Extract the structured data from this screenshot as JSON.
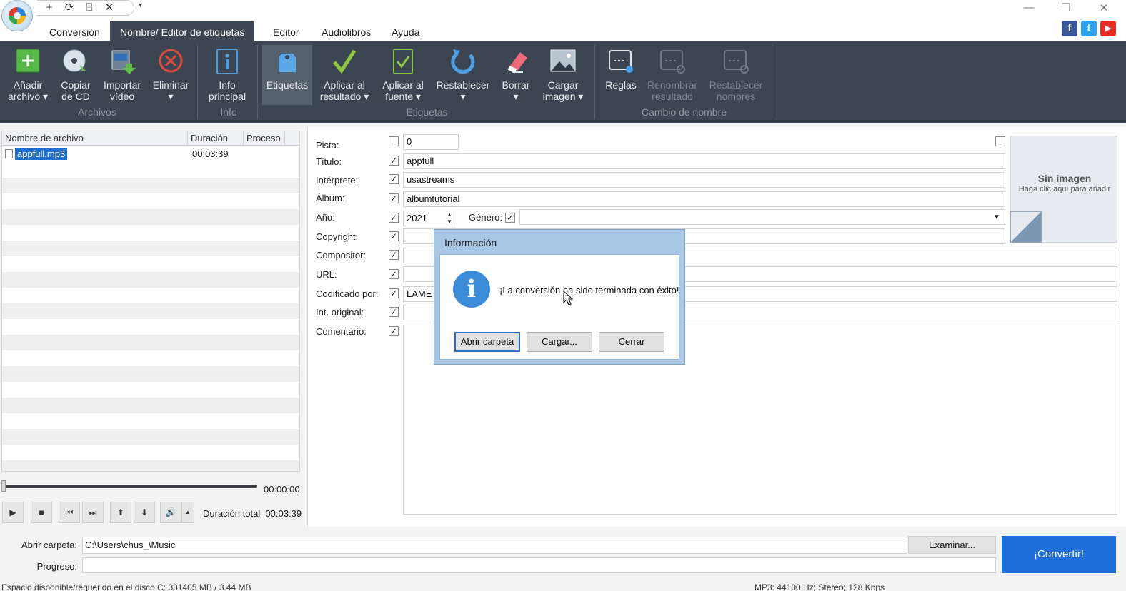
{
  "titlebar": {
    "qat_icons": [
      "plus-icon",
      "refresh-icon",
      "edit-doc-icon",
      "close-icon"
    ],
    "qat_glyphs": [
      "+",
      "⟳",
      "⌸",
      "✕"
    ],
    "more": "▾",
    "controls": {
      "minimize": "—",
      "restore": "❐",
      "close": "✕"
    }
  },
  "menu": {
    "tabs": [
      "Conversión",
      "Nombre/ Editor de etiquetas",
      "Editor",
      "Audiolibros",
      "Ayuda"
    ],
    "active": 1
  },
  "social": {
    "facebook": "f",
    "twitter": "t",
    "youtube": "▶",
    "colors": {
      "facebook": "#3b5998",
      "twitter": "#2aa3ef",
      "youtube": "#e52d27"
    }
  },
  "ribbon": {
    "buttons": [
      {
        "label": "Añadir\narchivo ▾",
        "icon": "add-file-icon"
      },
      {
        "label": "Copiar\nde CD",
        "icon": "cd-copy-icon"
      },
      {
        "label": "Importar\nvídeo",
        "icon": "import-video-icon"
      },
      {
        "label": "Eliminar\n▾",
        "icon": "delete-icon"
      },
      {
        "label": "Info\nprincipal",
        "icon": "info-icon"
      },
      {
        "label": "Etiquetas",
        "icon": "tag-icon"
      },
      {
        "label": "Aplicar al\nresultado ▾",
        "icon": "checkmark-icon"
      },
      {
        "label": "Aplicar al\nfuente ▾",
        "icon": "check-doc-icon"
      },
      {
        "label": "Restablecer\n▾",
        "icon": "undo-icon"
      },
      {
        "label": "Borrar\n▾",
        "icon": "eraser-icon"
      },
      {
        "label": "Cargar\nimagen ▾",
        "icon": "image-icon"
      },
      {
        "label": "Reglas",
        "icon": "rules-icon"
      },
      {
        "label": "Renombrar\nresultado",
        "icon": "rename-result-icon"
      },
      {
        "label": "Restablecer\nnombres",
        "icon": "reset-names-icon"
      }
    ],
    "groups": [
      "Archivos",
      "Info",
      "Etiquetas",
      "Cambio de nombre"
    ]
  },
  "filelist": {
    "columns": [
      "Nombre de archivo",
      "Duración",
      "Proceso"
    ],
    "rows": [
      {
        "name": "appfull.mp3",
        "duration": "00:03:39",
        "process": ""
      }
    ]
  },
  "player": {
    "position": "00:00:00",
    "total_label": "Duración total",
    "total": "00:03:39",
    "buttons": [
      "▶",
      "■",
      "⏮",
      "⏭",
      "⬆",
      "⬇",
      "🔊",
      "▲"
    ]
  },
  "tags": {
    "labels": {
      "pista": "Pista:",
      "titulo": "Título:",
      "interprete": "Intérprete:",
      "album": "Álbum:",
      "anio": "Año:",
      "genero": "Género:",
      "copyright": "Copyright:",
      "compositor": "Compositor:",
      "url": "URL:",
      "codificado": "Codificado por:",
      "original": "Int. original:",
      "comentario": "Comentario:"
    },
    "values": {
      "pista": "0",
      "titulo": "appfull",
      "interprete": "usastreams",
      "album": "albumtutorial",
      "anio": "2021",
      "genero": "",
      "copyright": "",
      "compositor": "",
      "url": "",
      "codificado": "LAME in",
      "original": "",
      "comentario": ""
    },
    "checkmark": "✓",
    "cover": {
      "title": "Sin imagen",
      "hint": "Haga clic aquí para añadir"
    }
  },
  "dialog": {
    "title": "Información",
    "message": "¡La conversión ha sido terminada con éxito!",
    "icon": "i",
    "buttons": {
      "open": "Abrir carpeta",
      "load": "Cargar...",
      "close": "Cerrar"
    }
  },
  "bottom": {
    "folder_label": "Abrir carpeta:",
    "folder_value": "C:\\Users\\chus_\\Music",
    "progress_label": "Progreso:",
    "browse": "Examinar...",
    "convert": "¡Convertir!",
    "status_left": "Espacio disponible/requerido en el disco C: 331405 MB / 3.44 MB",
    "status_right": "MP3: 44100 Hz; Stereo; 128 Kbps"
  },
  "colors": {
    "ribbon": "#3c4653",
    "accent": "#1e6fd9",
    "dialog_frame": "#a8c6e6"
  }
}
